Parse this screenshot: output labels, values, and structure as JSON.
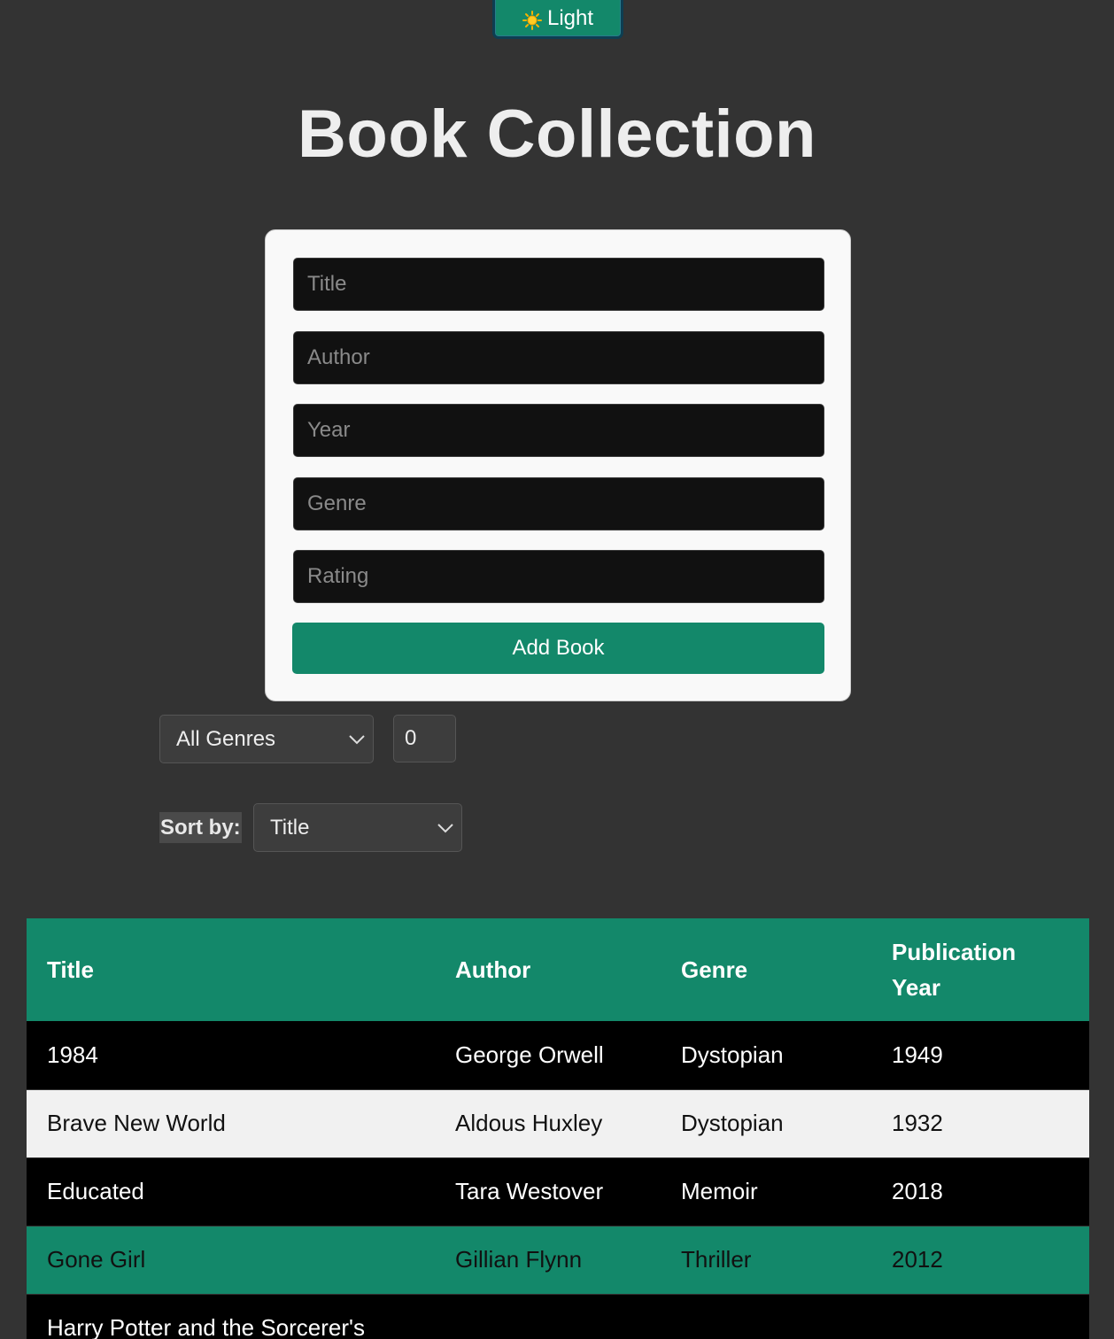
{
  "theme_toggle": {
    "label": "Light",
    "icon": "sun-icon"
  },
  "page_title": "Book Collection",
  "form": {
    "title_placeholder": "Title",
    "author_placeholder": "Author",
    "year_placeholder": "Year",
    "genre_placeholder": "Genre",
    "rating_placeholder": "Rating",
    "submit_label": "Add Book"
  },
  "filters": {
    "genre_selected": "All Genres",
    "min_rating_value": "0",
    "sort_label": "Sort by:",
    "sort_selected": "Title"
  },
  "table": {
    "headers": [
      "Title",
      "Author",
      "Genre",
      "Publication Year"
    ],
    "rows": [
      {
        "title": "1984",
        "author": "George Orwell",
        "genre": "Dystopian",
        "year": "1949"
      },
      {
        "title": "Brave New World",
        "author": "Aldous Huxley",
        "genre": "Dystopian",
        "year": "1932"
      },
      {
        "title": "Educated",
        "author": "Tara Westover",
        "genre": "Memoir",
        "year": "2018"
      },
      {
        "title": "Gone Girl",
        "author": "Gillian Flynn",
        "genre": "Thriller",
        "year": "2012"
      },
      {
        "title": "Harry Potter and the Sorcerer's",
        "author": "",
        "genre": "",
        "year": ""
      }
    ]
  },
  "colors": {
    "background": "#333333",
    "accent": "#13886a",
    "card": "#f9f9f9",
    "input_bg": "#111111"
  }
}
